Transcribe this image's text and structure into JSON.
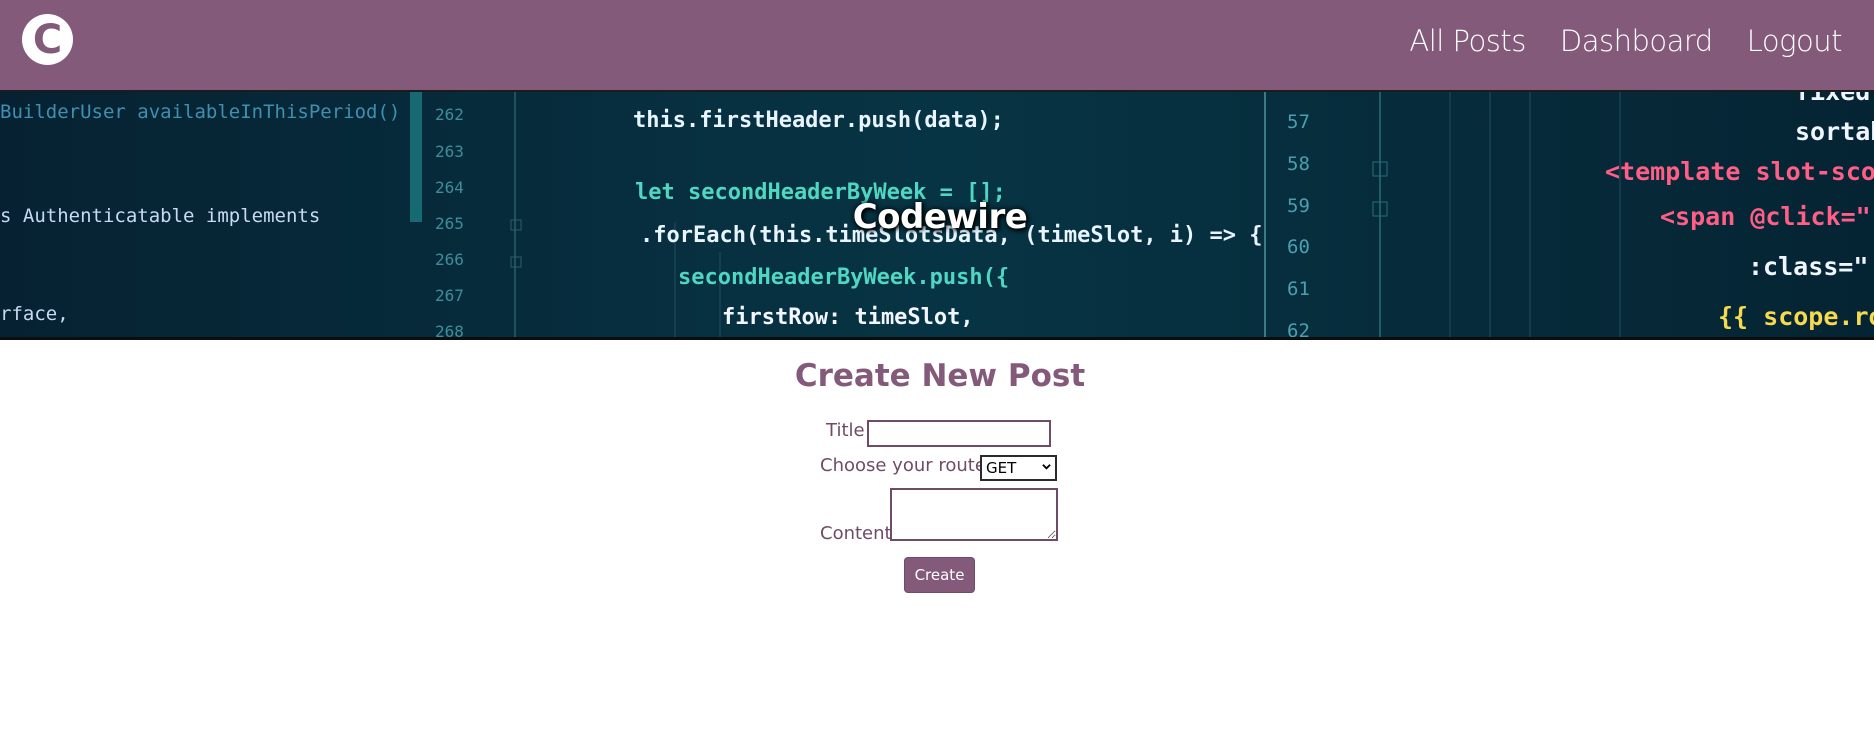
{
  "navbar": {
    "logo_letter": "C",
    "links": [
      {
        "label": "All Posts"
      },
      {
        "label": "Dashboard"
      },
      {
        "label": "Logout"
      }
    ]
  },
  "hero": {
    "title": "Codewire",
    "code_lines": {
      "left": [
        "BuilderUser availableInThisPeriod()",
        "s Authenticatable implements",
        "rface,"
      ],
      "line_numbers_left": [
        "262",
        "263",
        "264",
        "265",
        "266",
        "267",
        "268"
      ],
      "middle": [
        "this.firstHeader.push(data);",
        "let secondHeaderByWeek = [];",
        ".forEach(this.timeSlotsData, (timeSlot, i) => {",
        "secondHeaderByWeek.push({",
        "firstRow: timeSlot,"
      ],
      "line_numbers_right": [
        "57",
        "58",
        "59",
        "60",
        "61",
        "62"
      ],
      "right": [
        "fixed",
        "sortab",
        "<template slot-scop",
        "<span @click=\"",
        ":class=\"",
        "{{ scope.ro"
      ]
    }
  },
  "form": {
    "heading": "Create New Post",
    "title_label": "Title",
    "title_value": "",
    "route_label": "Choose your route:",
    "route_selected": "GET",
    "content_label": "Content",
    "content_value": "",
    "submit_label": "Create"
  },
  "colors": {
    "brand": "#845a7b",
    "label": "#6e4c68",
    "hero_bg": "#062b3a"
  }
}
